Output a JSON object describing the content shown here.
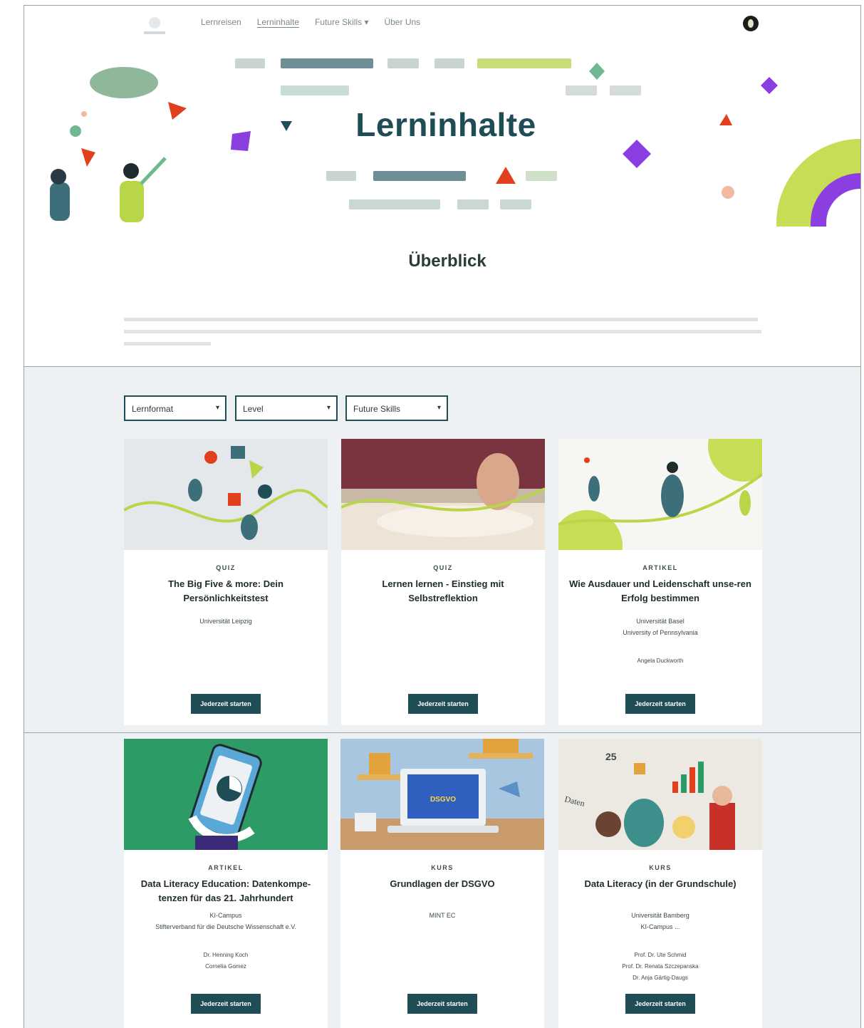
{
  "nav": {
    "items": [
      "Lernreisen",
      "Lerninhalte",
      "Future Skills ▾",
      "Über Uns"
    ]
  },
  "hero": {
    "title": "Lerninhalte"
  },
  "overview": {
    "title": "Überblick"
  },
  "filters": [
    {
      "label": "Lernformat"
    },
    {
      "label": "Level"
    },
    {
      "label": "Future Skills"
    }
  ],
  "cards": [
    {
      "type": "QUIZ",
      "title": "The Big Five & more: Dein Persönlichkeitstest",
      "institutions": [
        "Universität Leipzig"
      ],
      "authors": [],
      "button": "Jederzeit starten"
    },
    {
      "type": "QUIZ",
      "title": "Lernen lernen - Einstieg mit Selbstreflektion",
      "institutions": [],
      "authors": [],
      "button": "Jederzeit starten"
    },
    {
      "type": "ARTIKEL",
      "title": "Wie Ausdauer und Leidenschaft unse-ren Erfolg bestimmen",
      "institutions": [
        "Universität Basel",
        "University of Pennsylvania"
      ],
      "authors": [
        "Angela Duckworth"
      ],
      "button": "Jederzeit starten"
    },
    {
      "type": "ARTIKEL",
      "title": "Data Literacy Education: Datenkompe-tenzen für das 21. Jahrhundert",
      "institutions": [
        "KI-Campus",
        "Stifterverband für die Deutsche Wissenschaft e.V."
      ],
      "authors": [
        "Dr. Henning Koch",
        "Cornelia Gomez"
      ],
      "button": "Jederzeit starten"
    },
    {
      "type": "KURS",
      "title": "Grundlagen der DSGVO",
      "institutions": [
        "MINT EC"
      ],
      "authors": [],
      "button": "Jederzeit starten",
      "image_text": "DSGVO"
    },
    {
      "type": "KURS",
      "title": "Data Literacy (in der Grundschule)",
      "institutions": [
        "Universität Bamberg",
        "KI-Campus ..."
      ],
      "authors": [
        "Prof. Dr. Ute Schmid",
        "Prof. Dr. Renata Szczepanska",
        "Dr. Anja Gärtig-Daugs"
      ],
      "button": "Jederzeit starten",
      "image_text": [
        "25",
        "Daten"
      ]
    }
  ],
  "colors": {
    "accent": "#1f4d55",
    "lime": "#b9d649",
    "purple": "#8b3fe0",
    "red": "#e0401e",
    "panel": "#eef1f3"
  }
}
